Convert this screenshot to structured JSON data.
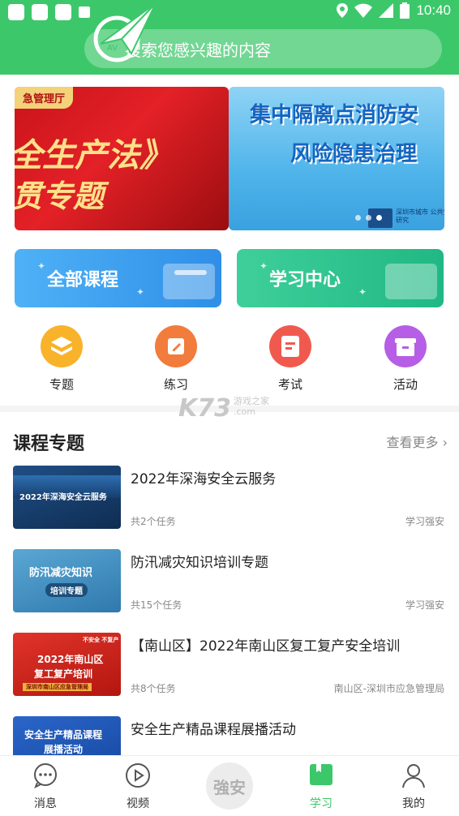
{
  "status_bar": {
    "time": "10:40"
  },
  "header": {
    "logo_text": "AV",
    "search_placeholder": "搜索您感兴趣的内容"
  },
  "banner": {
    "slide1": {
      "tag": "急管理厅",
      "line1": "全生产法》",
      "line2": "贯专题"
    },
    "slide2": {
      "line1": "集中隔离点消防安",
      "line2": "风险隐患治理",
      "org": "深圳市城市 公共安全技术研究"
    }
  },
  "quick": {
    "all_courses": "全部课程",
    "study_center": "学习中心"
  },
  "grid": [
    {
      "label": "专题",
      "icon": "layers-icon",
      "color": "#f8b32a"
    },
    {
      "label": "练习",
      "icon": "edit-icon",
      "color": "#f27c3b"
    },
    {
      "label": "考试",
      "icon": "document-icon",
      "color": "#f05a4e"
    },
    {
      "label": "活动",
      "icon": "gift-icon",
      "color": "#b65ee6"
    }
  ],
  "watermark": {
    "brand": "K73",
    "sub1": "游戏之家",
    "sub2": ".com"
  },
  "section": {
    "title": "课程专题",
    "more": "查看更多"
  },
  "courses": [
    {
      "title": "2022年深海安全云服务",
      "tasks": "共2个任务",
      "org": "学习强安",
      "thumb_text": "2022年深海安全云服务"
    },
    {
      "title": "防汛减灾知识培训专题",
      "tasks": "共15个任务",
      "org": "学习强安",
      "thumb_text": "防汛减灾知识",
      "thumb_text2": "培训专题"
    },
    {
      "title": "【南山区】2022年南山区复工复产安全培训",
      "tasks": "共8个任务",
      "org": "南山区-深圳市应急管理局",
      "thumb_text": "2022年南山区",
      "thumb_text2": "复工复产培训",
      "thumb_small": "不安全 不复产",
      "thumb_foot": "深圳市南山区应急管理局"
    },
    {
      "title": "安全生产精品课程展播活动",
      "thumb_text": "安全生产精品课程",
      "thumb_text2": "展播活动"
    }
  ],
  "nav": {
    "messages": "消息",
    "video": "视频",
    "center": "強安",
    "study": "学习",
    "mine": "我的"
  }
}
